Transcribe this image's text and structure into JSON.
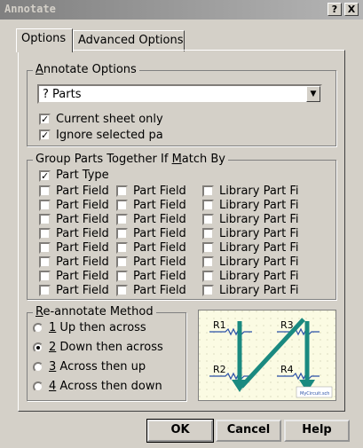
{
  "window": {
    "title": "Annotate"
  },
  "titlebar_buttons": {
    "help": "?",
    "close": "X"
  },
  "tabs": [
    {
      "label": "Options"
    },
    {
      "label": "Advanced Options"
    }
  ],
  "annotate_options": {
    "label_pre": "",
    "label_accel": "A",
    "label_post": "nnotate Options",
    "parts_select": "? Parts",
    "current_sheet_only": "Current sheet only",
    "ignore_selected": "Ignore selected pa",
    "current_sheet_checked": true,
    "ignore_selected_checked": true
  },
  "group_parts": {
    "label_pre": "Group Parts Together If ",
    "label_accel": "M",
    "label_post": "atch By",
    "part_type": "Part Type",
    "part_type_checked": true,
    "rows": [
      [
        "Part Field",
        "Part Field",
        "Library Part Fi"
      ],
      [
        "Part Field",
        "Part Field",
        "Library Part Fi"
      ],
      [
        "Part Field",
        "Part Field",
        "Library Part Fi"
      ],
      [
        "Part Field",
        "Part Field",
        "Library Part Fi"
      ],
      [
        "Part Field",
        "Part Field",
        "Library Part Fi"
      ],
      [
        "Part Field",
        "Part Field",
        "Library Part Fi"
      ],
      [
        "Part Field",
        "Part Field",
        "Library Part Fi"
      ],
      [
        "Part Field",
        "Part Field",
        "Library Part Fi"
      ]
    ]
  },
  "reannotate": {
    "label_pre": "",
    "label_accel": "R",
    "label_post": "e-annotate Method",
    "options": [
      {
        "accel": "1",
        "label": " Up then across",
        "selected": false
      },
      {
        "accel": "2",
        "label": " Down then across",
        "selected": true
      },
      {
        "accel": "3",
        "label": " Across then up",
        "selected": false
      },
      {
        "accel": "4",
        "label": " Across then down",
        "selected": false
      }
    ]
  },
  "preview": {
    "labels": [
      "R1",
      "R3",
      "R2",
      "R4"
    ],
    "watermark": "MyCircuit.sch",
    "arrow_color": "#1a8a80"
  },
  "buttons": {
    "ok": "OK",
    "cancel": "Cancel",
    "help": "Help"
  }
}
